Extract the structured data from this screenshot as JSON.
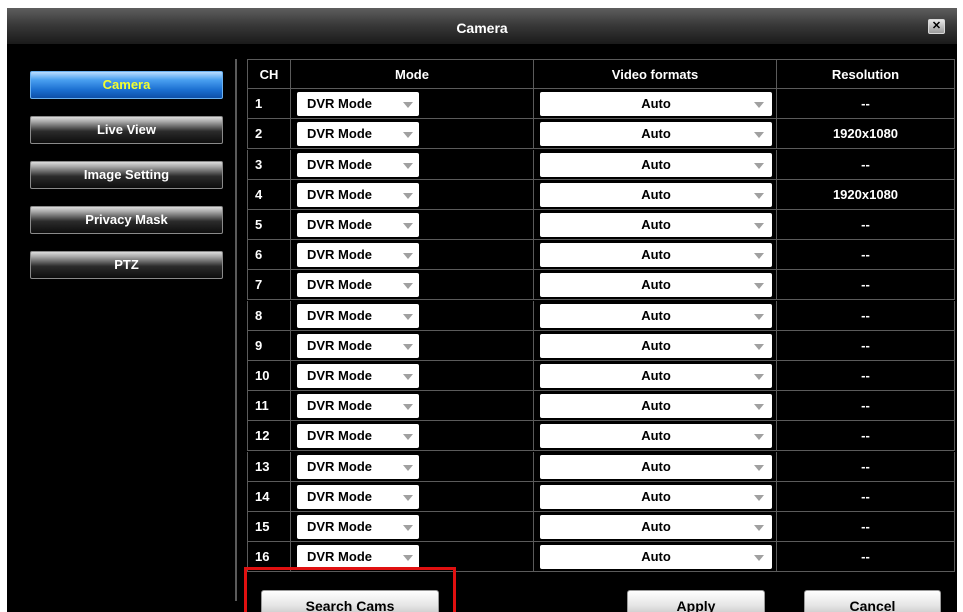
{
  "window": {
    "title": "Camera",
    "close_glyph": "✕"
  },
  "sidebar": {
    "items": [
      {
        "label": "Camera",
        "active": true
      },
      {
        "label": "Live View",
        "active": false
      },
      {
        "label": "Image Setting",
        "active": false
      },
      {
        "label": "Privacy Mask",
        "active": false
      },
      {
        "label": "PTZ",
        "active": false
      }
    ]
  },
  "table": {
    "headers": {
      "ch": "CH",
      "mode": "Mode",
      "video": "Video formats",
      "resolution": "Resolution"
    },
    "rows": [
      {
        "ch": "1",
        "mode": "DVR Mode",
        "video": "Auto",
        "resolution": "--"
      },
      {
        "ch": "2",
        "mode": "DVR Mode",
        "video": "Auto",
        "resolution": "1920x1080"
      },
      {
        "ch": "3",
        "mode": "DVR Mode",
        "video": "Auto",
        "resolution": "--"
      },
      {
        "ch": "4",
        "mode": "DVR Mode",
        "video": "Auto",
        "resolution": "1920x1080"
      },
      {
        "ch": "5",
        "mode": "DVR Mode",
        "video": "Auto",
        "resolution": "--"
      },
      {
        "ch": "6",
        "mode": "DVR Mode",
        "video": "Auto",
        "resolution": "--"
      },
      {
        "ch": "7",
        "mode": "DVR Mode",
        "video": "Auto",
        "resolution": "--"
      },
      {
        "ch": "8",
        "mode": "DVR Mode",
        "video": "Auto",
        "resolution": "--"
      },
      {
        "ch": "9",
        "mode": "DVR Mode",
        "video": "Auto",
        "resolution": "--"
      },
      {
        "ch": "10",
        "mode": "DVR Mode",
        "video": "Auto",
        "resolution": "--"
      },
      {
        "ch": "11",
        "mode": "DVR Mode",
        "video": "Auto",
        "resolution": "--"
      },
      {
        "ch": "12",
        "mode": "DVR Mode",
        "video": "Auto",
        "resolution": "--"
      },
      {
        "ch": "13",
        "mode": "DVR Mode",
        "video": "Auto",
        "resolution": "--"
      },
      {
        "ch": "14",
        "mode": "DVR Mode",
        "video": "Auto",
        "resolution": "--"
      },
      {
        "ch": "15",
        "mode": "DVR Mode",
        "video": "Auto",
        "resolution": "--"
      },
      {
        "ch": "16",
        "mode": "DVR Mode",
        "video": "Auto",
        "resolution": "--"
      }
    ]
  },
  "footer": {
    "search_label": "Search Cams",
    "apply_label": "Apply",
    "cancel_label": "Cancel"
  },
  "colors": {
    "active_text": "#f4ff2e",
    "active_bg": "#1a6ed0",
    "highlight": "#e01010"
  }
}
